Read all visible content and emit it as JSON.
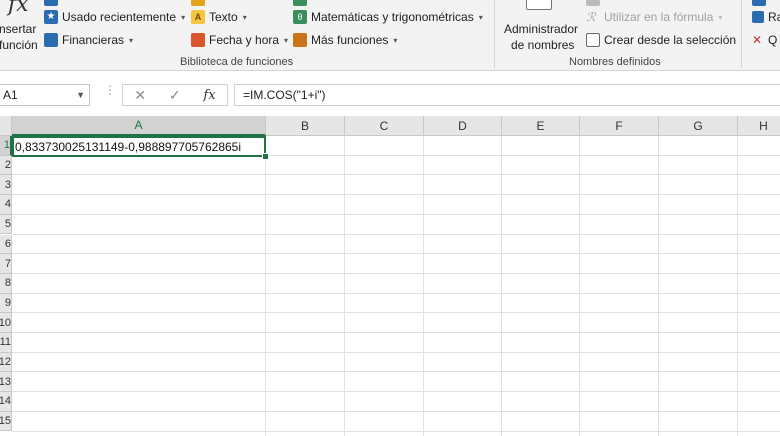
{
  "ribbon": {
    "insert_function": {
      "line1": "nsertar",
      "line2": "función",
      "icon": "fx-icon"
    },
    "library": {
      "recently_used": "Usado recientemente",
      "financial": "Financieras",
      "text": "Texto",
      "date_time": "Fecha y hora",
      "math_trig": "Matemáticas y trigonométricas",
      "more_functions": "Más funciones",
      "group_label": "Biblioteca de funciones"
    },
    "names": {
      "manager_line1": "Administrador",
      "manager_line2": "de nombres",
      "use_in_formula": "Utilizar en la fórmula",
      "create_from_selection": "Crear desde la selección",
      "group_label": "Nombres definidos"
    },
    "audit": {
      "trace": "Ra",
      "remove": "Q"
    }
  },
  "formula_bar": {
    "name_box": "A1",
    "cancel_icon": "✕",
    "enter_icon": "✓",
    "fx_label": "fx",
    "formula": "=IM.COS(\"1+i\")"
  },
  "grid": {
    "columns": [
      "A",
      "B",
      "C",
      "D",
      "E",
      "F",
      "G",
      "H"
    ],
    "rows": [
      "1",
      "2",
      "3",
      "4",
      "5",
      "6",
      "7",
      "8",
      "9",
      "10",
      "11",
      "12",
      "13",
      "14",
      "15"
    ],
    "active_cell_value": "0,833730025131149-0,988897705762865i"
  },
  "colors": {
    "accent": "#217346",
    "header_bg": "#e6e6e6",
    "ribbon_bg": "#f3f3f3"
  }
}
